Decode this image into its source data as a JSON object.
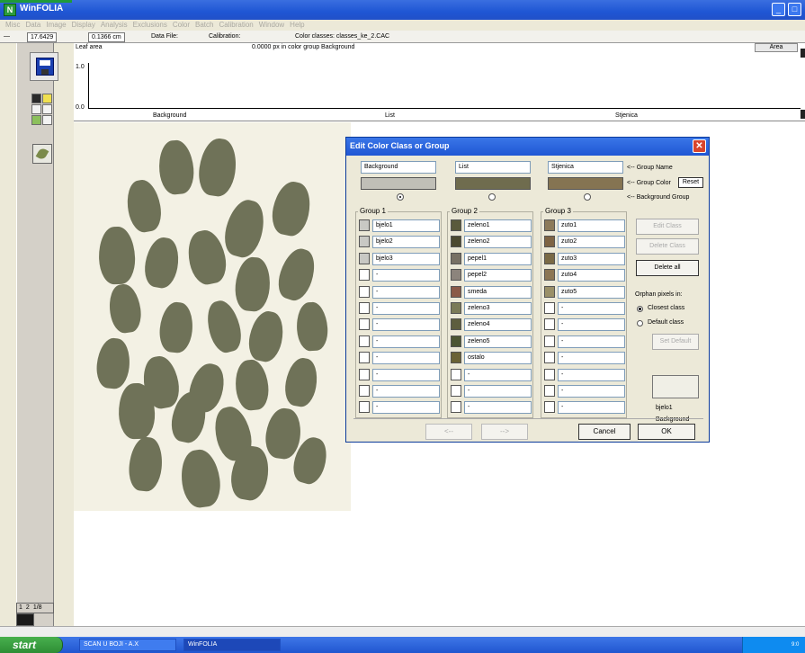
{
  "window": {
    "title": "WinFOLIA",
    "controls": [
      "_",
      "□"
    ]
  },
  "menu": [
    "Misc",
    "Data",
    "Image",
    "Display",
    "Analysis",
    "Exclusions",
    "Color",
    "Batch",
    "Calibration",
    "Window",
    "Help"
  ],
  "status": {
    "value1": "17.6429",
    "value2": "0.1366 cm",
    "datafile_label": "Data File:",
    "calibration_label": "Calibration:",
    "colorclass_label": "Color classes: classes_ke_2.CAC"
  },
  "chart_data": {
    "type": "bar",
    "title": "Leaf area",
    "subtitle": "0.0000 px in color group Background",
    "categories": [
      "Background",
      "List",
      "Stjenica"
    ],
    "values": [
      0,
      0,
      0
    ],
    "ylim": [
      0,
      1
    ],
    "ytick_labels": [
      "1.0",
      "0.0"
    ],
    "legend_button": "Area"
  },
  "left": {
    "page": "1/8",
    "page_left": "1",
    "page_right": "2"
  },
  "dialog": {
    "title": "Edit Color Class or Group",
    "groups": [
      {
        "name": "Background",
        "color": "#c0bfb7",
        "label": "Group 1",
        "background": true
      },
      {
        "name": "List",
        "color": "#6f6c4e",
        "label": "Group 2",
        "background": false
      },
      {
        "name": "Stjenica",
        "color": "#857452",
        "label": "Group 3",
        "background": false
      }
    ],
    "group_name_label": "<-- Group Name",
    "group_color_label": "<-- Group Color",
    "reset_label": "Reset",
    "background_group_label": "<-- Background Group",
    "group1": [
      {
        "name": "bjelo1",
        "color": "#c8c8c4"
      },
      {
        "name": "bjelo2",
        "color": "#c8c8c4"
      },
      {
        "name": "bjelo3",
        "color": "#c8c8c4"
      },
      {
        "name": "-",
        "color": "#ffffff"
      },
      {
        "name": "-",
        "color": "#ffffff"
      },
      {
        "name": "-",
        "color": "#ffffff"
      },
      {
        "name": "-",
        "color": "#ffffff"
      },
      {
        "name": "-",
        "color": "#ffffff"
      },
      {
        "name": "-",
        "color": "#ffffff"
      },
      {
        "name": "-",
        "color": "#ffffff"
      },
      {
        "name": "-",
        "color": "#ffffff"
      },
      {
        "name": "-",
        "color": "#ffffff"
      }
    ],
    "group2": [
      {
        "name": "zeleno1",
        "color": "#5a5a3c"
      },
      {
        "name": "zeleno2",
        "color": "#4c4a30"
      },
      {
        "name": "pepel1",
        "color": "#777064"
      },
      {
        "name": "pepel2",
        "color": "#8c847c"
      },
      {
        "name": "smeda",
        "color": "#8a5a48"
      },
      {
        "name": "zeleno3",
        "color": "#7a7a58"
      },
      {
        "name": "zeleno4",
        "color": "#5e5e3e"
      },
      {
        "name": "zeleno5",
        "color": "#4c5634"
      },
      {
        "name": "ostalo",
        "color": "#6a6236"
      },
      {
        "name": "-",
        "color": "#ffffff"
      },
      {
        "name": "-",
        "color": "#ffffff"
      },
      {
        "name": "-",
        "color": "#ffffff"
      }
    ],
    "group3": [
      {
        "name": "zuto1",
        "color": "#8c7a5a"
      },
      {
        "name": "zuto2",
        "color": "#7e6444"
      },
      {
        "name": "zuto3",
        "color": "#7a6a46"
      },
      {
        "name": "zuto4",
        "color": "#8c7654"
      },
      {
        "name": "zuto5",
        "color": "#9a9068"
      },
      {
        "name": "-",
        "color": "#ffffff"
      },
      {
        "name": "-",
        "color": "#ffffff"
      },
      {
        "name": "-",
        "color": "#ffffff"
      },
      {
        "name": "-",
        "color": "#ffffff"
      },
      {
        "name": "-",
        "color": "#ffffff"
      },
      {
        "name": "-",
        "color": "#ffffff"
      },
      {
        "name": "-",
        "color": "#ffffff"
      }
    ],
    "buttons": {
      "edit_class": "Edit Class",
      "delete_class": "Delete Class",
      "delete_all": "Delete all",
      "set_default": "Set Default",
      "prev": "<--",
      "next": "-->",
      "cancel": "Cancel",
      "ok": "OK"
    },
    "orphan": {
      "label": "Orphan pixels in:",
      "closest": "Closest class",
      "default": "Default class",
      "selected": "closest"
    },
    "preview": {
      "class_name": "bjelo1",
      "group_name": "Background"
    }
  },
  "taskbar": {
    "start": "start",
    "items": [
      {
        "label": "SCAN U BOJI - A.X",
        "active": false
      },
      {
        "label": "WinFOLIA",
        "active": true
      }
    ],
    "clock": "9:0"
  },
  "colors": {
    "titlebar": "#1f56d4",
    "dialog_bg": "#ece9d8",
    "leaf": "#6f7258",
    "paper": "#f3f1e4"
  }
}
